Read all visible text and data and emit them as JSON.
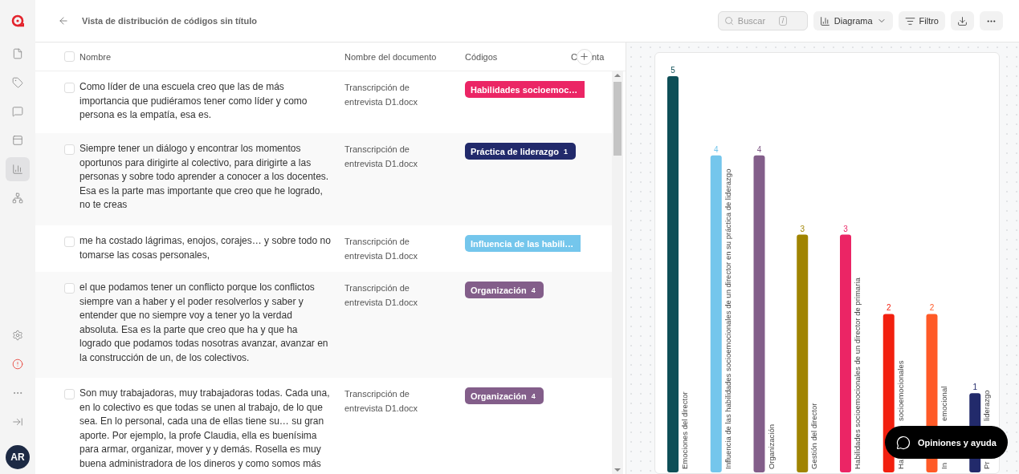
{
  "sidebar": {
    "top_items": [
      {
        "kind": "documents",
        "selected": false
      },
      {
        "kind": "codes",
        "selected": false
      },
      {
        "kind": "memos",
        "selected": false
      },
      {
        "kind": "board",
        "selected": false
      },
      {
        "kind": "chart",
        "selected": true
      },
      {
        "kind": "network",
        "selected": false
      }
    ],
    "bottom_items": [
      {
        "kind": "settings"
      },
      {
        "kind": "alert"
      },
      {
        "kind": "more"
      },
      {
        "kind": "collapse"
      }
    ],
    "avatar": "AR"
  },
  "header": {
    "title": "Vista de distribución de códigos sin título",
    "search": {
      "placeholder": "Buscar",
      "shortcut": "/"
    },
    "view_button": "Diagrama",
    "filter_button": "Filtro"
  },
  "table": {
    "select_all_checked": false,
    "columns": [
      {
        "label": "Nombre"
      },
      {
        "label": "Nombre del documento"
      },
      {
        "label": "Códigos"
      },
      {
        "label": "C",
        "label_tail": "nta"
      }
    ],
    "rows": [
      {
        "selected": false,
        "text": "Como líder de una escuela creo que las de más importancia que pudiéramos tener como líder y como persona es la empatía, esa es.",
        "document": "Transcripción de entrevista D1.docx",
        "code": {
          "label": "Habilidades socioemoc…",
          "color": "#eb2565",
          "cut": true
        }
      },
      {
        "selected": false,
        "text": "Siempre tener un diálogo y encontrar los momentos oportunos para dirigirte al colectivo, para dirigirte a las personas y sobre todo aprender a conocer a los docentes. Esa es la parte mas importante que creo que he logrado, no te creas",
        "document": "Transcripción de entrevista D1.docx",
        "code": {
          "label": "Práctica de liderazgo",
          "color": "#222a6b",
          "count": "1",
          "cut": false
        }
      },
      {
        "selected": false,
        "text": "me ha costado lágrimas, enojos, corajes… y sobre todo no tomarse las cosas personales,",
        "document": "Transcripción de entrevista D1.docx",
        "code": {
          "label": "Influencia de las habili…",
          "color": "#74c6ec",
          "cut": true
        }
      },
      {
        "selected": false,
        "text": "el que podamos tener un conflicto porque los conflictos siempre van a haber y el poder resolverlos y saber y entender que no siempre voy a tener yo la verdad absoluta. Esa es la parte que creo que ha y que ha logrado que podamos todas nosotras avanzar, avanzar en la construcción de un, de los colectivos.",
        "document": "Transcripción de entrevista D1.docx",
        "code": {
          "label": "Organización",
          "color": "#835e8a",
          "count": "4",
          "cut": false
        }
      },
      {
        "selected": false,
        "text": "Son muy trabajadoras, muy trabajadoras todas. Cada una, en lo colectivo es que todas se unen al trabajo, de lo que sea. En lo personal, cada una de ellas tiene su… su gran aporte. Por ejemplo, la profe Claudia, ella es buenísima para armar, organizar, mover y y demás. Rosella es muy buena administradora de los dineros y como somos más",
        "document": "Transcripción de entrevista D1.docx",
        "code": {
          "label": "Organización",
          "color": "#835e8a",
          "count": "4",
          "cut": false
        }
      }
    ]
  },
  "chart": {
    "chart_data": {
      "type": "bar",
      "categories": [
        "Emociones del director",
        "Influencia de las habilidades socioemocionales de un director en su práctica de liderazgo",
        "Organización",
        "Gestión del director",
        "Habilidades socioemocionales de un director de primaria",
        "Ha",
        "In",
        "Pr"
      ],
      "annotations": [
        "socioemocionales",
        "emocional",
        "liderazgo"
      ],
      "values": [
        5,
        4,
        4,
        3,
        3,
        2,
        2,
        1
      ],
      "colors": [
        "#0e4f57",
        "#74c6ec",
        "#835e8a",
        "#a08400",
        "#eb2565",
        "#f2200f",
        "#ff5a27",
        "#222a6b"
      ],
      "data_labels": true
    }
  },
  "feedback_button": "Opiniones y ayuda"
}
